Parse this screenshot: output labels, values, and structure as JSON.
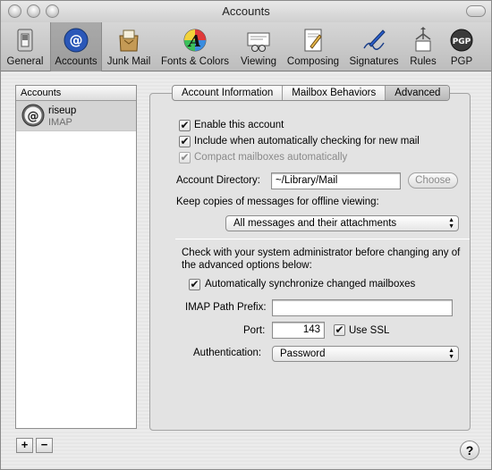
{
  "window": {
    "title": "Accounts"
  },
  "toolbar": {
    "items": [
      {
        "label": "General",
        "icon": "switch-icon"
      },
      {
        "label": "Accounts",
        "icon": "at-sign-icon"
      },
      {
        "label": "Junk Mail",
        "icon": "junk-mail-icon"
      },
      {
        "label": "Fonts & Colors",
        "icon": "font-palette-icon"
      },
      {
        "label": "Viewing",
        "icon": "viewing-icon"
      },
      {
        "label": "Composing",
        "icon": "composing-icon"
      },
      {
        "label": "Signatures",
        "icon": "signature-pen-icon"
      },
      {
        "label": "Rules",
        "icon": "rules-icon"
      },
      {
        "label": "PGP",
        "icon": "pgp-icon"
      }
    ],
    "selected": "Accounts"
  },
  "sidebar": {
    "header": "Accounts",
    "accounts": [
      {
        "name": "riseup",
        "type": "IMAP"
      }
    ],
    "add_label": "+",
    "remove_label": "−"
  },
  "tabs": {
    "items": [
      "Account Information",
      "Mailbox Behaviors",
      "Advanced"
    ],
    "active": "Advanced"
  },
  "advanced": {
    "enable_account": {
      "label": "Enable this account",
      "checked": true
    },
    "include_check": {
      "label": "Include when automatically checking for new mail",
      "checked": true
    },
    "compact": {
      "label": "Compact mailboxes automatically",
      "checked": true,
      "disabled": true
    },
    "account_directory_label": "Account Directory:",
    "account_directory_value": "~/Library/Mail",
    "choose_label": "Choose",
    "offline_label": "Keep copies of messages for offline viewing:",
    "offline_value": "All messages and their attachments",
    "admin_note_line1": "Check with your system administrator before changing any of",
    "admin_note_line2": "the advanced options below:",
    "auto_sync": {
      "label": "Automatically synchronize changed mailboxes",
      "checked": true
    },
    "imap_prefix_label": "IMAP Path Prefix:",
    "imap_prefix_value": "",
    "port_label": "Port:",
    "port_value": "143",
    "use_ssl": {
      "label": "Use SSL",
      "checked": true
    },
    "auth_label": "Authentication:",
    "auth_value": "Password"
  },
  "help_label": "?",
  "check_glyph": "✔"
}
